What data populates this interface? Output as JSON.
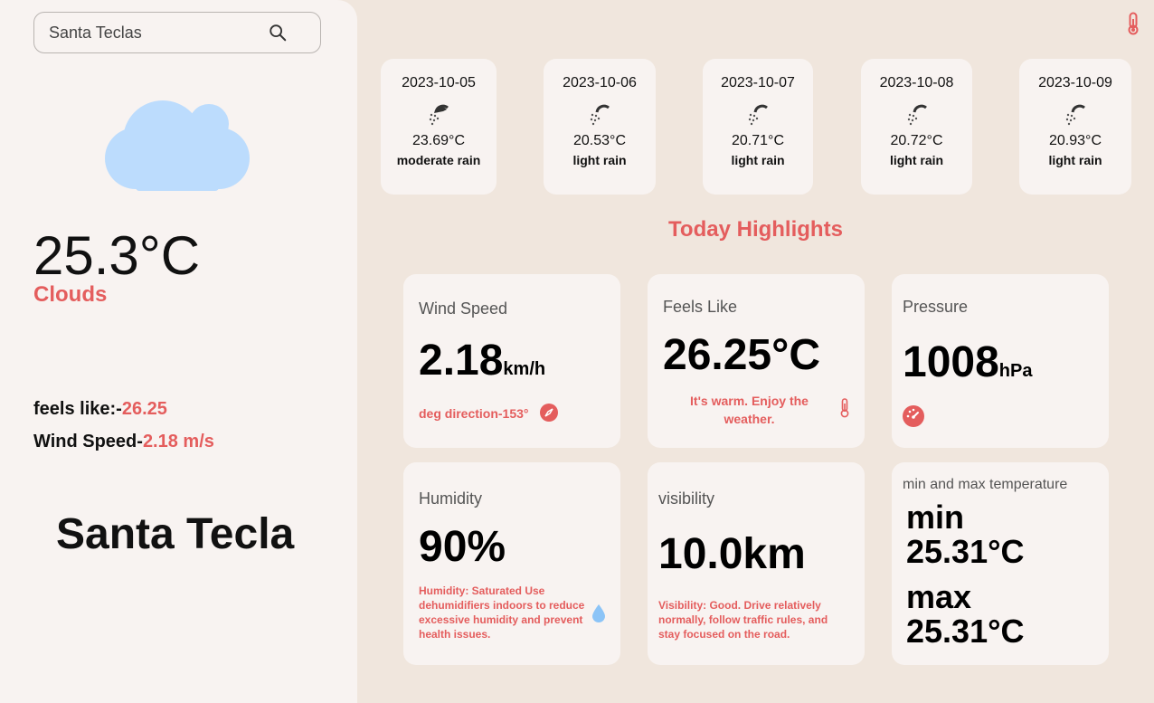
{
  "search": {
    "value": "Santa Teclas",
    "icon": "search-icon"
  },
  "current": {
    "temperature": "25.3°C",
    "condition": "Clouds",
    "feels_like_label": "feels like:-",
    "feels_like_value": "26.25",
    "wind_label": "Wind Speed-",
    "wind_value": "2.18 m/s",
    "city": "Santa Tecla",
    "icon": "cloud-icon"
  },
  "forecast": [
    {
      "date": "2023-10-05",
      "temp": "23.69°C",
      "desc": "moderate rain",
      "icon": "rain-icon"
    },
    {
      "date": "2023-10-06",
      "temp": "20.53°C",
      "desc": "light rain",
      "icon": "rain-icon"
    },
    {
      "date": "2023-10-07",
      "temp": "20.71°C",
      "desc": "light rain",
      "icon": "rain-icon"
    },
    {
      "date": "2023-10-08",
      "temp": "20.72°C",
      "desc": "light rain",
      "icon": "rain-icon"
    },
    {
      "date": "2023-10-09",
      "temp": "20.93°C",
      "desc": "light rain",
      "icon": "rain-icon"
    }
  ],
  "highlights": {
    "title": "Today Highlights",
    "wind": {
      "title": "Wind Speed",
      "value": "2.18",
      "unit": "km/h",
      "note": "deg direction-153°"
    },
    "feels": {
      "title": "Feels Like",
      "value": "26.25°C",
      "note": "It's warm. Enjoy the weather."
    },
    "pressure": {
      "title": "Pressure",
      "value": "1008",
      "unit": "hPa"
    },
    "humidity": {
      "title": "Humidity",
      "value": "90%",
      "note": "Humidity: Saturated Use dehumidifiers indoors to reduce excessive humidity and prevent health issues."
    },
    "visibility": {
      "title": "visibility",
      "value": "10.0km",
      "note": "Visibility: Good. Drive relatively normally, follow traffic rules, and stay focused on the road."
    },
    "minmax": {
      "title": "min and max temperature",
      "min_label": "min",
      "min_value": "25.31°C",
      "max_label": "max",
      "max_value": "25.31°C"
    }
  },
  "colors": {
    "accent": "#e45d5d",
    "sidebar": "#f8f3f1",
    "background": "#f0e6dd",
    "cloud": "#bcdcfd",
    "drop": "#8cc4f7"
  }
}
